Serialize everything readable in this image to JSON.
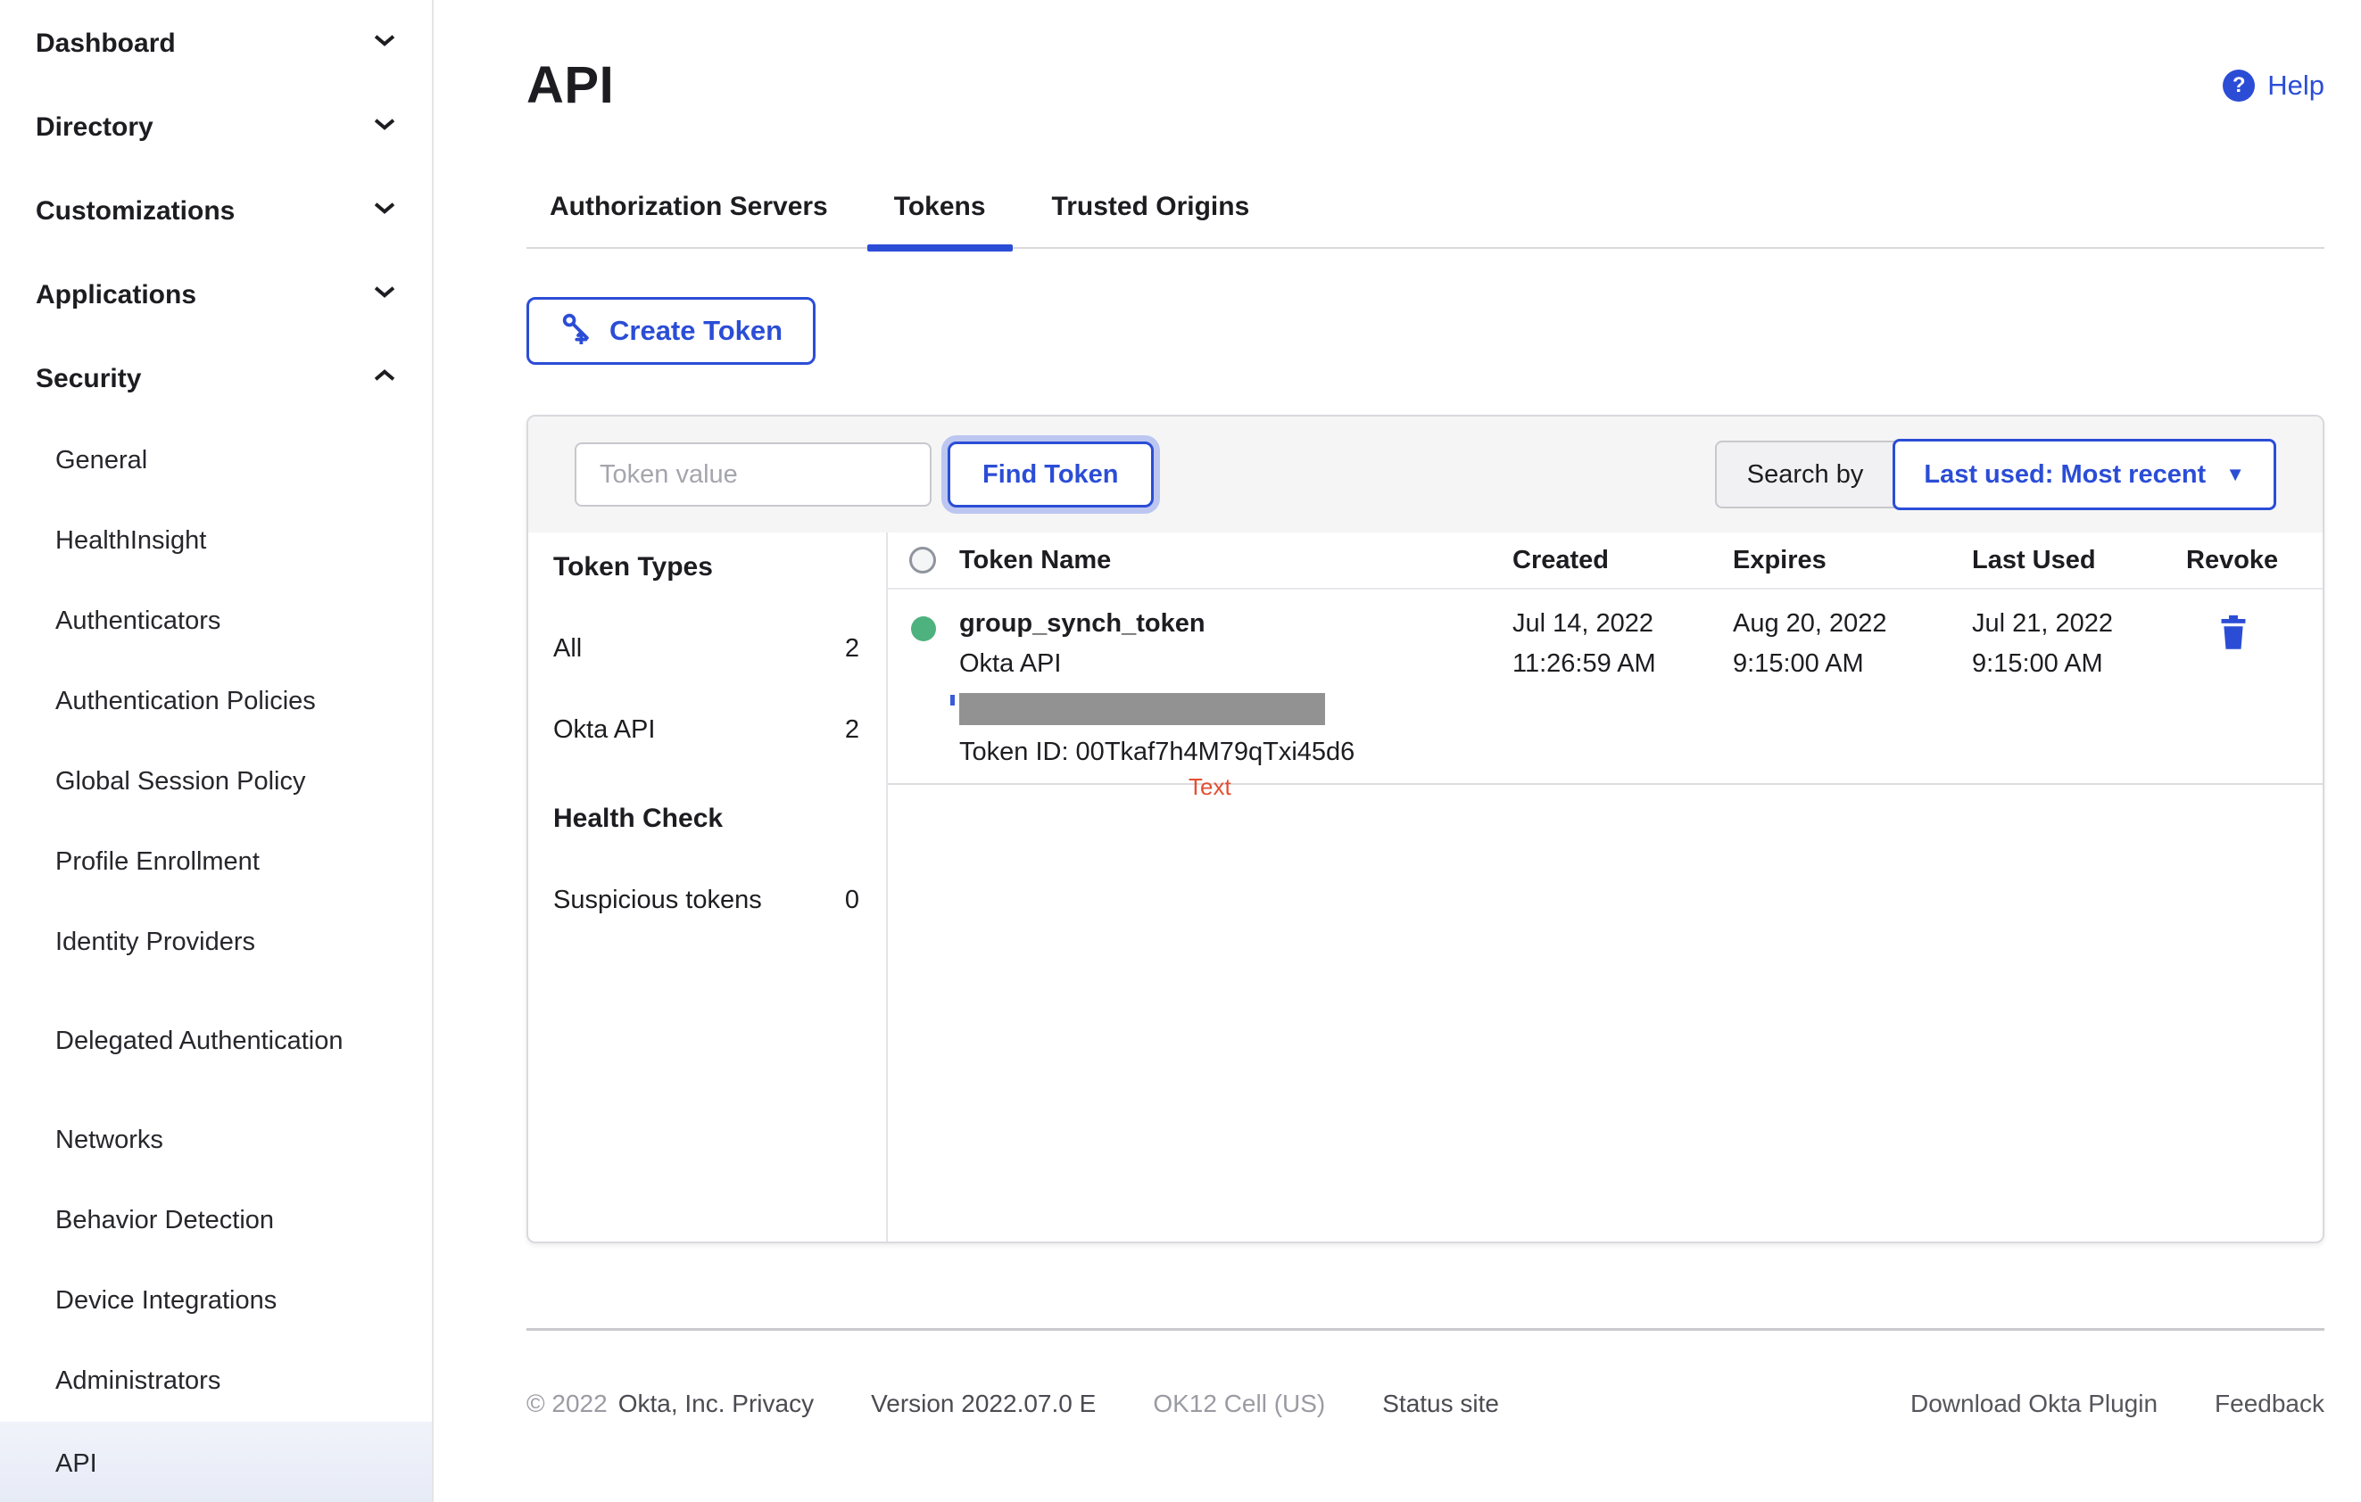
{
  "colors": {
    "accent": "#2b4dd6",
    "status_green": "#4db27e",
    "annotation_red": "#e34f32",
    "redaction_gray": "#929292"
  },
  "sidebar": {
    "items": [
      {
        "label": "Dashboard",
        "chevron": "down"
      },
      {
        "label": "Directory",
        "chevron": "down"
      },
      {
        "label": "Customizations",
        "chevron": "down"
      },
      {
        "label": "Applications",
        "chevron": "down"
      },
      {
        "label": "Security",
        "chevron": "up"
      }
    ],
    "security_items": [
      {
        "label": "General"
      },
      {
        "label": "HealthInsight"
      },
      {
        "label": "Authenticators"
      },
      {
        "label": "Authentication Policies"
      },
      {
        "label": "Global Session Policy"
      },
      {
        "label": "Profile Enrollment"
      },
      {
        "label": "Identity Providers"
      },
      {
        "label": "Delegated Authentication"
      },
      {
        "label": "Networks"
      },
      {
        "label": "Behavior Detection"
      },
      {
        "label": "Device Integrations"
      },
      {
        "label": "Administrators"
      },
      {
        "label": "API"
      }
    ]
  },
  "header": {
    "title": "API",
    "help_label": "Help",
    "help_glyph": "?"
  },
  "tabs": {
    "items": [
      {
        "label": "Authorization Servers"
      },
      {
        "label": "Tokens"
      },
      {
        "label": "Trusted Origins"
      }
    ]
  },
  "toolbar": {
    "create_token_label": "Create Token"
  },
  "search": {
    "placeholder": "Token value",
    "find_label": "Find Token",
    "search_by_label": "Search by",
    "sort_value": "Last used: Most recent",
    "caret": "▼"
  },
  "filters": {
    "token_types_title": "Token Types",
    "types": [
      {
        "label": "All",
        "count": "2"
      },
      {
        "label": "Okta API",
        "count": "2"
      }
    ],
    "health_title": "Health Check",
    "health": [
      {
        "label": "Suspicious tokens",
        "count": "0"
      }
    ]
  },
  "table": {
    "columns": [
      "Token Name",
      "Created",
      "Expires",
      "Last Used",
      "Revoke"
    ],
    "rows": [
      {
        "name": "group_synch_token",
        "type": "Okta API",
        "token_id": "Token ID: 00Tkaf7h4M79qTxi45d6",
        "created_date": "Jul 14, 2022",
        "created_time": "11:26:59 AM",
        "expires_date": "Aug 20, 2022",
        "expires_time": "9:15:00 AM",
        "last_used_date": "Jul 21, 2022",
        "last_used_time": "9:15:00 AM"
      }
    ]
  },
  "annotation": {
    "label": "Text"
  },
  "footer": {
    "copyright": "© 2022",
    "company": "Okta, Inc. Privacy",
    "version": "Version 2022.07.0 E",
    "cell": "OK12 Cell (US)",
    "status_site": "Status site",
    "download_plugin": "Download Okta Plugin",
    "feedback": "Feedback"
  }
}
